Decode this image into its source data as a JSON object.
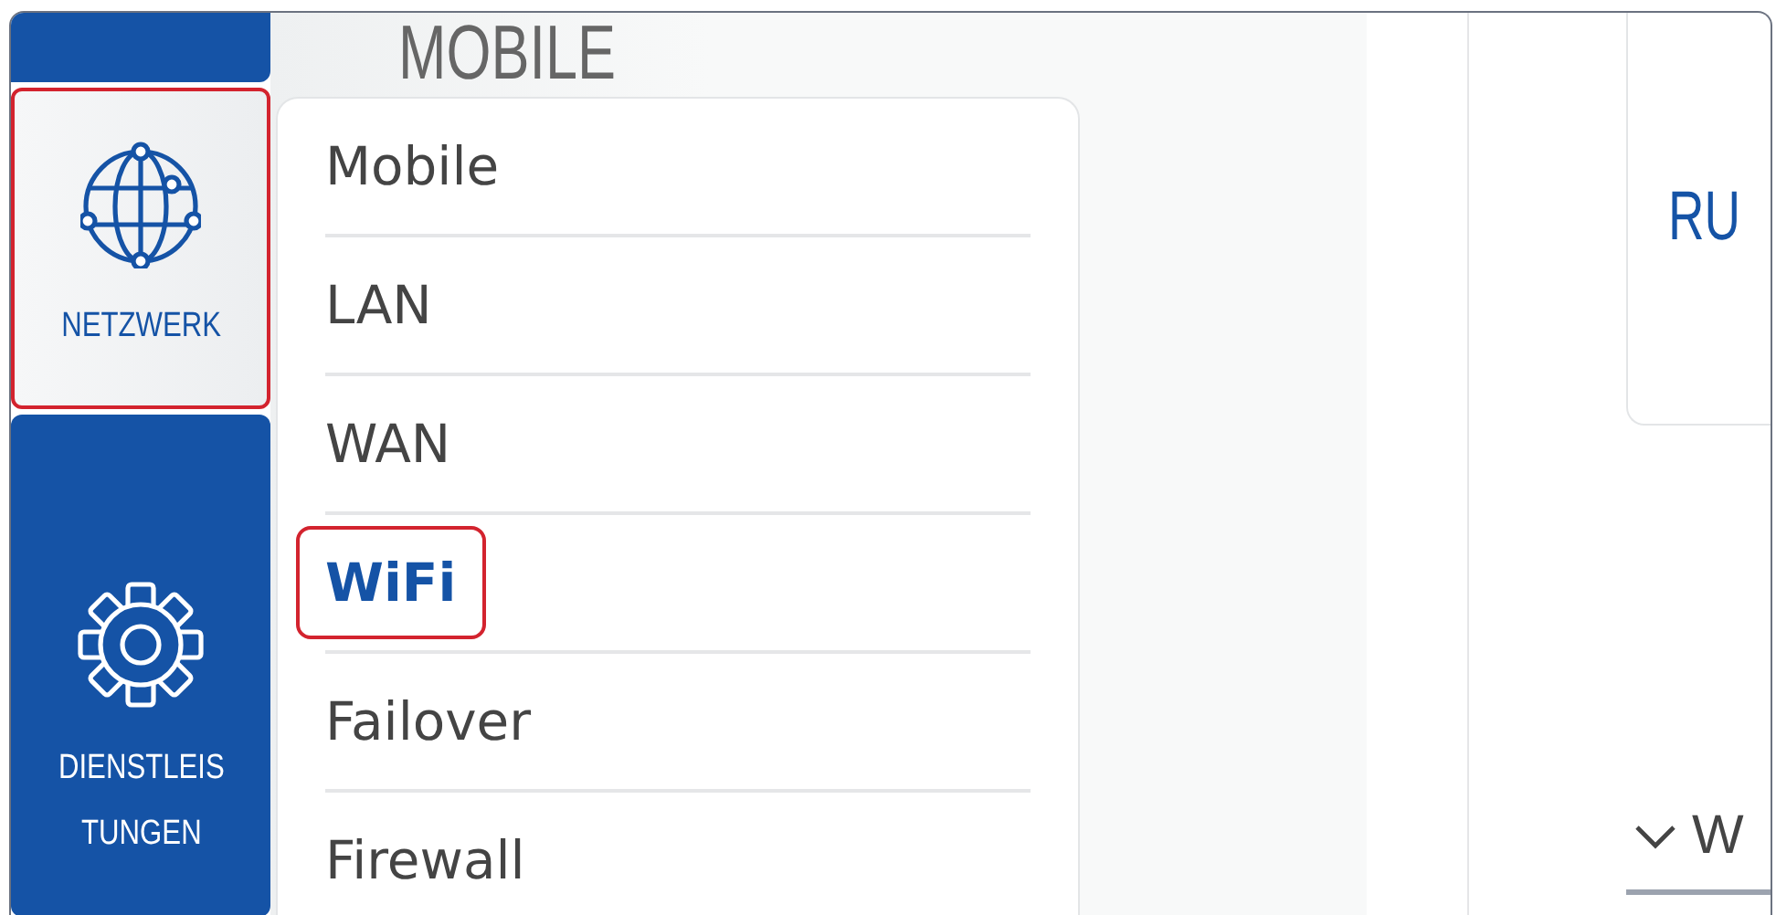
{
  "sidebar": {
    "items": [
      {
        "kind": "blank",
        "selected": false,
        "highlighted": false
      },
      {
        "kind": "globe",
        "label_lines": [
          "NETZWERK"
        ],
        "selected": true,
        "highlighted": true
      },
      {
        "kind": "gear",
        "label_lines": [
          "DIENSTLEIS",
          "TUNGEN"
        ],
        "selected": false,
        "highlighted": false
      }
    ]
  },
  "section": {
    "title": "MOBILE"
  },
  "menu": {
    "items": [
      {
        "label": "Mobile",
        "selected": false,
        "highlighted": false
      },
      {
        "label": "LAN",
        "selected": false,
        "highlighted": false
      },
      {
        "label": "WAN",
        "selected": false,
        "highlighted": false
      },
      {
        "label": "WiFi",
        "selected": true,
        "highlighted": true
      },
      {
        "label": "Failover",
        "selected": false,
        "highlighted": false
      },
      {
        "label": "Firewall",
        "selected": false,
        "highlighted": false
      }
    ]
  },
  "right_panel": {
    "card_title": "RU",
    "section_label": "W",
    "expanded": false
  }
}
